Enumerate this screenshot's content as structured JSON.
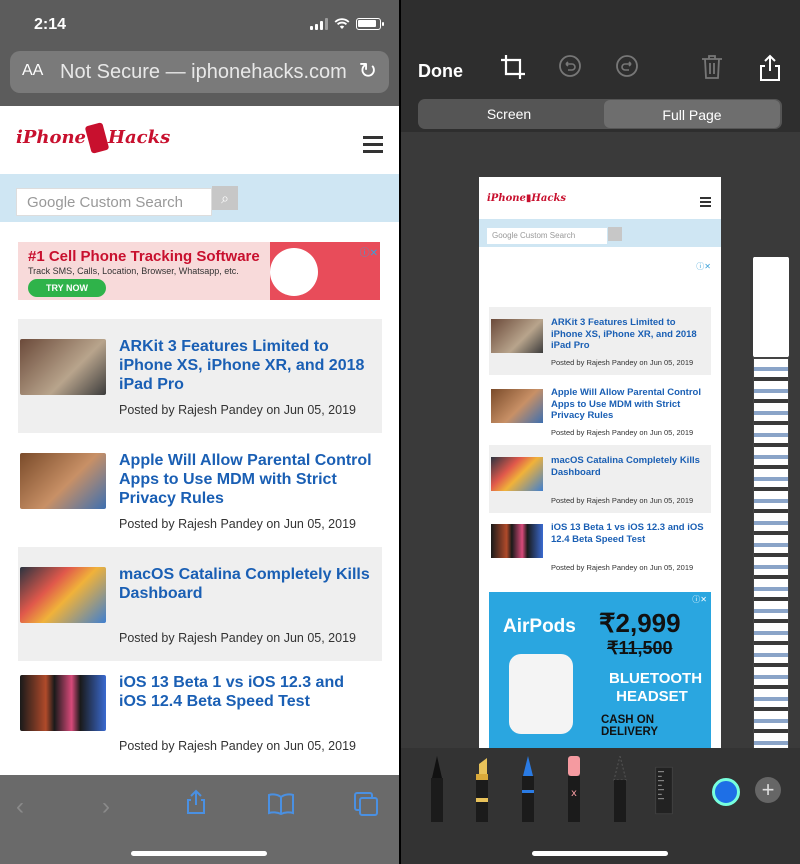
{
  "safari": {
    "status": {
      "time": "2:14"
    },
    "url": {
      "aa": "AA",
      "text": "Not Secure — iphonehacks.com"
    },
    "site": {
      "logo_text_left": "iPhone",
      "logo_text_right": "Hacks",
      "search_placeholder": "Google Custom Search"
    },
    "ad": {
      "headline": "#1 Cell Phone Tracking Software",
      "subline": "Track SMS, Calls, Location, Browser, Whatsapp, etc.",
      "button": "TRY NOW"
    },
    "posts": [
      {
        "title": "ARKit 3 Features Limited to iPhone XS, iPhone XR, and 2018 iPad Pro",
        "meta": "Posted by Rajesh Pandey on Jun 05, 2019"
      },
      {
        "title": "Apple Will Allow Parental Control Apps to Use MDM with Strict Privacy Rules",
        "meta": "Posted by Rajesh Pandey on Jun 05, 2019"
      },
      {
        "title": "macOS Catalina Completely Kills Dashboard",
        "meta": "Posted by Rajesh Pandey on Jun 05, 2019"
      },
      {
        "title": "iOS 13 Beta 1 vs iOS 12.3 and iOS 12.4 Beta Speed Test",
        "meta": "Posted by Rajesh Pandey on Jun 05, 2019"
      }
    ]
  },
  "editor": {
    "done_label": "Done",
    "segments": [
      "Screen",
      "Full Page"
    ],
    "selected_segment": "Full Page",
    "preview_posts": [
      {
        "title": "ARKit 3 Features Limited to iPhone XS, iPhone XR, and 2018 iPad Pro",
        "meta": "Posted by Rajesh Pandey on Jun 05, 2019"
      },
      {
        "title": "Apple Will Allow Parental Control Apps to Use MDM with Strict Privacy Rules",
        "meta": "Posted by Rajesh Pandey on Jun 05, 2019"
      },
      {
        "title": "macOS Catalina Completely Kills Dashboard",
        "meta": "Posted by Rajesh Pandey on Jun 05, 2019"
      },
      {
        "title": "iOS 13 Beta 1 vs iOS 12.3 and iOS 12.4 Beta Speed Test",
        "meta": "Posted by Rajesh Pandey on Jun 05, 2019"
      }
    ],
    "preview_ad": {
      "brand": "AirPods",
      "price": "₹2,999",
      "old_price": "₹11,500",
      "line1": "BLUETOOTH HEADSET",
      "line2": "CASH ON DELIVERY"
    }
  },
  "colors": {
    "link_blue": "#1a5fb4",
    "brand_red": "#c8102e",
    "search_band": "#cfe6f3",
    "toolbar_blue": "#4a90e2"
  }
}
